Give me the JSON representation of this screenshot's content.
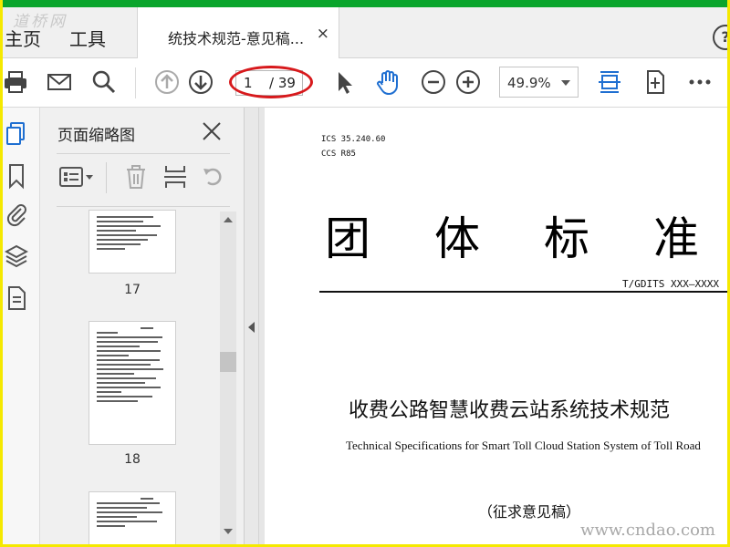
{
  "watermarks": {
    "top_left": "道桥网",
    "bottom_right": "www.cndao.com"
  },
  "tabs": {
    "home": "主页",
    "tools": "工具",
    "document": "统技术规范-意见稿...",
    "close_glyph": "×",
    "help_glyph": "?"
  },
  "toolbar": {
    "current_page": "1",
    "total_pages": "/ 39",
    "zoom": "49.9%",
    "highlight_color": "#d7191c"
  },
  "thumbnails_panel": {
    "title": "页面缩略图",
    "pages": [
      {
        "number": "17"
      },
      {
        "number": "18"
      },
      {
        "number": ""
      }
    ]
  },
  "document": {
    "ics": "ICS 35.240.60",
    "ccs": "CCS R85",
    "standard_title_chars": [
      "团",
      "体",
      "标",
      "准"
    ],
    "standard_number": "T/GDITS XXX—XXXX",
    "title_cn": "收费公路智慧收费云站系统技术规范",
    "title_en": "Technical Specifications for Smart Toll Cloud Station System of Toll Road",
    "draft_label": "（征求意见稿）"
  },
  "colors": {
    "accent_blue": "#1f6fd1",
    "frame_yellow": "#f5e900",
    "top_green": "#0aa52c"
  }
}
